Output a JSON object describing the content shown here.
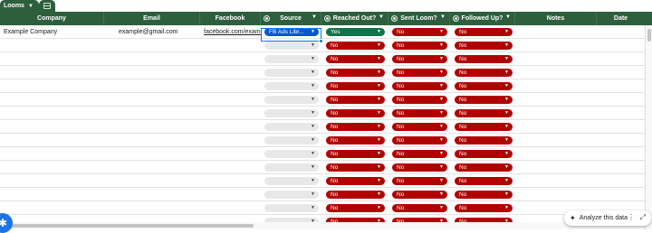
{
  "tabs": [
    {
      "label": "Looms"
    }
  ],
  "header": {
    "company": "Company",
    "email": "Email",
    "facebook": "Facebook",
    "source": "Source",
    "reached_out": "Reached Out?",
    "sent_loom": "Sent Loom?",
    "followed_up": "Followed Up?",
    "notes": "Notes",
    "date": "Date"
  },
  "rows": [
    {
      "company": "Example Company",
      "email": "example@gmail.com",
      "facebook": "facebook.com/example",
      "source": "FB Ads Libr...",
      "reached_out": "Yes",
      "sent_loom": "No",
      "followed_up": "No"
    },
    {
      "company": "",
      "email": "",
      "facebook": "",
      "source": "",
      "reached_out": "No",
      "sent_loom": "No",
      "followed_up": "No"
    },
    {
      "company": "",
      "email": "",
      "facebook": "",
      "source": "",
      "reached_out": "No",
      "sent_loom": "No",
      "followed_up": "No"
    },
    {
      "company": "",
      "email": "",
      "facebook": "",
      "source": "",
      "reached_out": "No",
      "sent_loom": "No",
      "followed_up": "No"
    },
    {
      "company": "",
      "email": "",
      "facebook": "",
      "source": "",
      "reached_out": "No",
      "sent_loom": "No",
      "followed_up": "No"
    },
    {
      "company": "",
      "email": "",
      "facebook": "",
      "source": "",
      "reached_out": "No",
      "sent_loom": "No",
      "followed_up": "No"
    },
    {
      "company": "",
      "email": "",
      "facebook": "",
      "source": "",
      "reached_out": "No",
      "sent_loom": "No",
      "followed_up": "No"
    },
    {
      "company": "",
      "email": "",
      "facebook": "",
      "source": "",
      "reached_out": "No",
      "sent_loom": "No",
      "followed_up": "No"
    },
    {
      "company": "",
      "email": "",
      "facebook": "",
      "source": "",
      "reached_out": "No",
      "sent_loom": "No",
      "followed_up": "No"
    },
    {
      "company": "",
      "email": "",
      "facebook": "",
      "source": "",
      "reached_out": "No",
      "sent_loom": "No",
      "followed_up": "No"
    },
    {
      "company": "",
      "email": "",
      "facebook": "",
      "source": "",
      "reached_out": "No",
      "sent_loom": "No",
      "followed_up": "No"
    },
    {
      "company": "",
      "email": "",
      "facebook": "",
      "source": "",
      "reached_out": "No",
      "sent_loom": "No",
      "followed_up": "No"
    },
    {
      "company": "",
      "email": "",
      "facebook": "",
      "source": "",
      "reached_out": "No",
      "sent_loom": "No",
      "followed_up": "No"
    },
    {
      "company": "",
      "email": "",
      "facebook": "",
      "source": "",
      "reached_out": "No",
      "sent_loom": "No",
      "followed_up": "No"
    },
    {
      "company": "",
      "email": "",
      "facebook": "",
      "source": "",
      "reached_out": "No",
      "sent_loom": "No",
      "followed_up": "No"
    }
  ],
  "analyze": {
    "label": "Analyze this data"
  },
  "colors": {
    "header_bg": "#2d5f3c",
    "chip_no": "#b10202",
    "chip_yes": "#11734b",
    "chip_source": "#0b57d0",
    "selection": "#1a73e8"
  },
  "icons": {
    "tab_chevron": "chevron-down-icon",
    "tab_sheet": "sheet-table-icon",
    "column_type": "dropdown-column-icon",
    "analyze": "sparkle-icon",
    "fab": "gemini-icon"
  }
}
